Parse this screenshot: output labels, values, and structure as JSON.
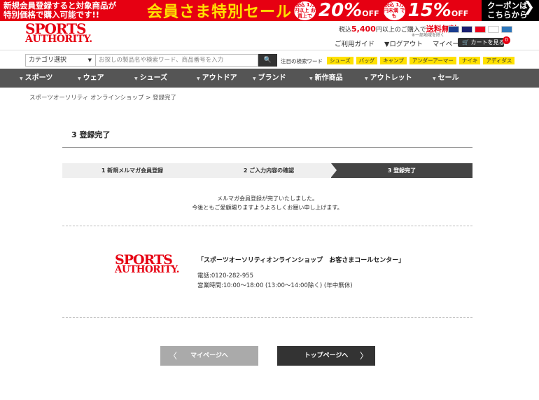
{
  "banner": {
    "lead_line1": "新規会員登録すると対象商品が",
    "lead_line2": "特別価格で購入可能です!!",
    "sale_text": "会員さま特別セール",
    "offer1_cond": "税込 1万円以上 お買上で",
    "offer1_pct": "20%",
    "offer1_off": "OFF",
    "offer2_cond": "税込 1万円未満 でも",
    "offer2_pct": "15%",
    "offer2_off": "OFF",
    "coupon_line1": "クーポンは",
    "coupon_line2": "こちらから",
    "coupon_chevron": "❯",
    "color_red": "#e60012",
    "color_yellow": "#ffe100"
  },
  "header": {
    "logo_line1": "SPORTS",
    "logo_line2": "AUTHORITY.",
    "free_ship_prefix": "税込",
    "free_ship_amount": "5,400",
    "free_ship_middle": "円以上のご購入で",
    "free_ship_label": "送料無料",
    "free_ship_note": "※一部地域を除く",
    "link_guide": "ご利用ガイド",
    "link_logout": "▼ログアウト",
    "link_mypage": "マイページ",
    "cart_label": "カートを見る",
    "cart_count": "0"
  },
  "search": {
    "category_label": "カテゴリ選択",
    "category_caret": "▼",
    "placeholder": "お探しの製品名や検索ワード、商品番号を入力",
    "button_icon": "🔍",
    "keywords_label": "注目の検索ワード",
    "keywords": [
      "シューズ",
      "バッグ",
      "キャンプ",
      "アンダーアーマー",
      "ナイキ",
      "アディダス"
    ]
  },
  "nav": {
    "marker": "▼",
    "items": [
      "スポーツ",
      "ウェア",
      "シューズ",
      "アウトドア",
      "ブランド",
      "新作商品",
      "アウトレット",
      "セール"
    ]
  },
  "breadcrumb": {
    "text": "スポーツオーソリティ オンラインショップ > 登録完了"
  },
  "page": {
    "title": "3  登録完了",
    "steps": [
      "1 新規メルマガ会員登録",
      "2 ご入力内容の確認",
      "3  登録完了"
    ],
    "message_line1": "メルマガ会員登録が完了いたしました。",
    "message_line2": "今後ともご愛顧賜りますようよろしくお願い申し上げます。"
  },
  "call_center": {
    "logo_line1": "SPORTS",
    "logo_line2": "AUTHORITY.",
    "name": "「スポーツオーソリティオンラインショップ　お客さまコールセンター」",
    "phone": "電話:0120-282-955",
    "hours": "営業時間:10:00～18:00 (13:00～14:00除く) (年中無休)"
  },
  "buttons": {
    "mypage_label": "マイページへ",
    "mypage_chevron": "〈",
    "top_label": "トップページへ",
    "top_chevron": "〉"
  }
}
